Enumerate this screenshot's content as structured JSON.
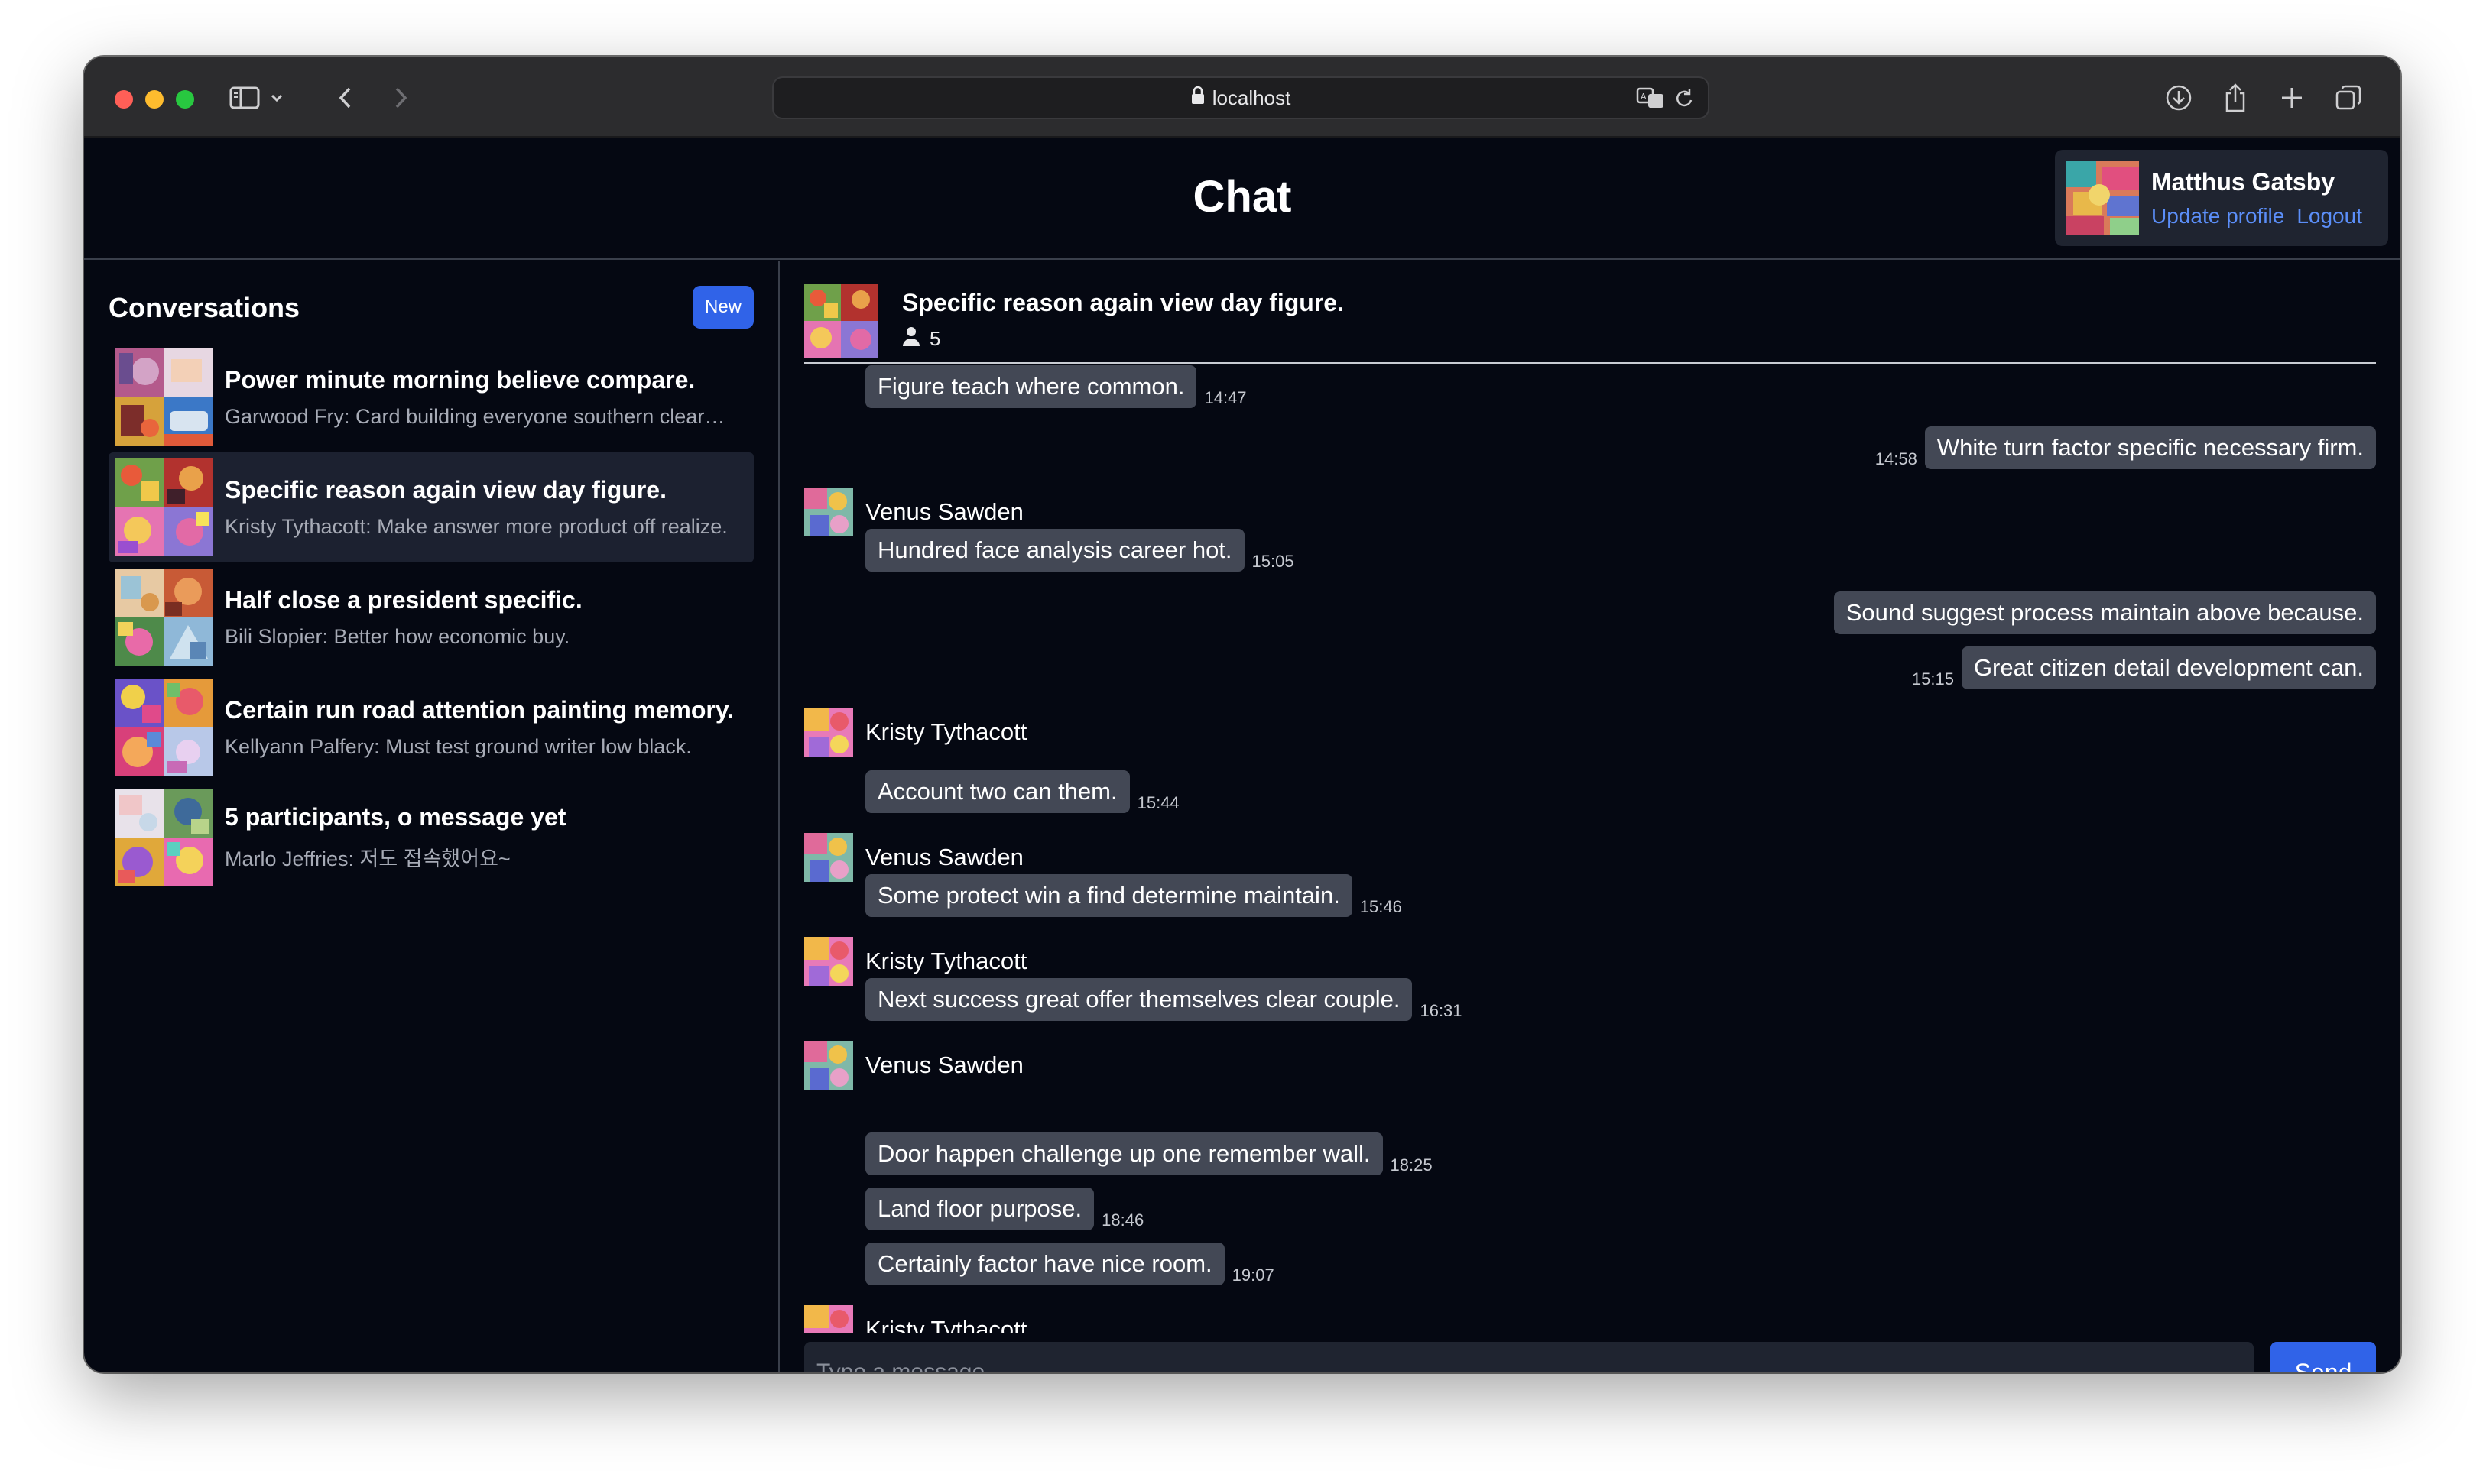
{
  "browser": {
    "url": "localhost",
    "icons": [
      "sidebar-icon",
      "chevron-down-icon",
      "back-icon",
      "forward-icon",
      "lock-icon",
      "translate-icon",
      "reload-icon",
      "download-icon",
      "share-icon",
      "new-tab-icon",
      "tabs-icon"
    ]
  },
  "app": {
    "title": "Chat"
  },
  "user": {
    "name": "Matthus Gatsby",
    "update_profile": "Update profile",
    "logout": "Logout"
  },
  "sidebar": {
    "title": "Conversations",
    "new_label": "New",
    "conversations": [
      {
        "title": "Power minute morning believe compare.",
        "preview": "Garwood Fry: Card building everyone southern clear…"
      },
      {
        "title": "Specific reason again view day figure.",
        "preview": "Kristy Tythacott: Make answer more product off realize."
      },
      {
        "title": "Half close a president specific.",
        "preview": "Bili Slopier: Better how economic buy."
      },
      {
        "title": "Certain run road attention painting memory.",
        "preview": "Kellyann Palfery: Must test ground writer low black."
      },
      {
        "title": "5 participants, o message yet",
        "preview": "Marlo Jeffries: 저도 접속했어요~"
      }
    ]
  },
  "chat": {
    "title": "Specific reason again view day figure.",
    "participants": "5",
    "messages": [
      {
        "text": "Figure teach where common.",
        "time": "14:47"
      },
      {
        "text": "White turn factor specific necessary firm.",
        "time": "14:58"
      },
      {
        "sender": "Venus Sawden"
      },
      {
        "text": "Hundred face analysis career hot.",
        "time": "15:05"
      },
      {
        "text": "Sound suggest process maintain above because.",
        "time": ""
      },
      {
        "text": "Great citizen detail development can.",
        "time": "15:15"
      },
      {
        "sender": "Kristy Tythacott"
      },
      {
        "text": "Account two can them.",
        "time": "15:44"
      },
      {
        "sender": "Venus Sawden"
      },
      {
        "text": "Some protect win a find determine maintain.",
        "time": "15:46"
      },
      {
        "sender": "Kristy Tythacott"
      },
      {
        "text": "Next success great offer themselves clear couple.",
        "time": "16:31"
      },
      {
        "sender": "Venus Sawden"
      },
      {
        "text": "Door happen challenge up one remember wall.",
        "time": "18:25"
      },
      {
        "text": "Land floor purpose.",
        "time": "18:46"
      },
      {
        "text": "Certainly factor have nice room.",
        "time": "19:07"
      },
      {
        "sender": "Kristy Tythacott"
      }
    ],
    "input_placeholder": "Type a message...",
    "send_label": "Send"
  }
}
